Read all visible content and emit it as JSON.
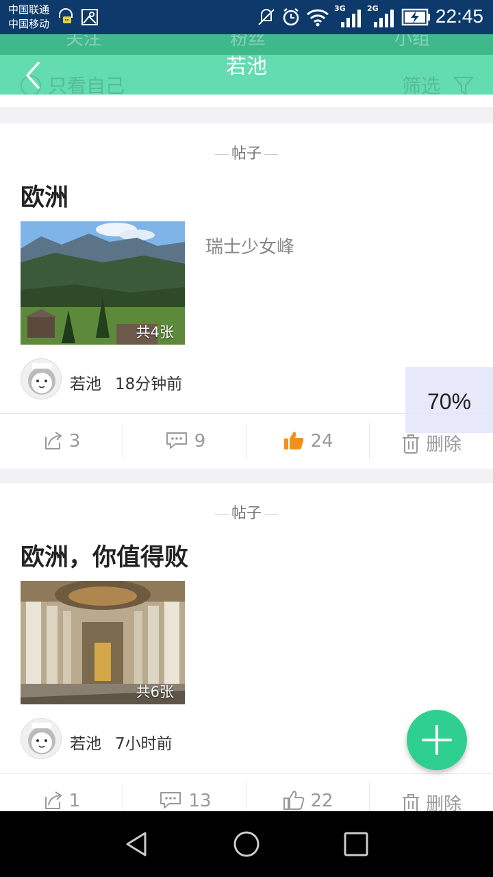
{
  "status_bar": {
    "carrier_1": "中国联通",
    "carrier_2": "中国移动",
    "net_1": "3G",
    "net_2": "2G",
    "time": "22:45"
  },
  "header": {
    "ghost_tabs": [
      "关注",
      "粉丝",
      "小组"
    ],
    "title": "若池",
    "only_self_label": "只看自己",
    "filter_label": "筛选"
  },
  "posts": [
    {
      "tag": "帖子",
      "title": "欧洲",
      "description": "瑞士少女峰",
      "image_count": "共4张",
      "author": "若池",
      "time": "18分钟前",
      "share_count": "3",
      "comment_count": "9",
      "like_count": "24",
      "liked": true,
      "delete_label": "删除"
    },
    {
      "tag": "帖子",
      "title": "欧洲，你值得败",
      "description": "",
      "image_count": "共6张",
      "author": "若池",
      "time": "7小时前",
      "share_count": "1",
      "comment_count": "13",
      "like_count": "22",
      "liked": false,
      "delete_label": "删除"
    }
  ],
  "zoom_indicator": "70%",
  "colors": {
    "status_bar": "#0d3a6a",
    "title_bar": "#63dcaf",
    "fab": "#2ecf8f",
    "like_active": "#f39019",
    "icon_gray": "#999999"
  },
  "icons": {
    "back": "chevron-left-icon",
    "share": "share-icon",
    "comment": "comment-icon",
    "like": "thumbs-up-icon",
    "delete": "trash-icon",
    "fab": "plus-icon"
  }
}
